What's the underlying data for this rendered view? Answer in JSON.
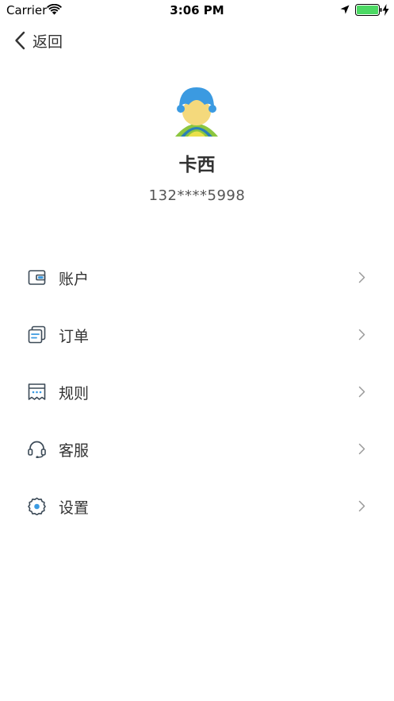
{
  "status_bar": {
    "carrier": "Carrier",
    "time": "3:06 PM",
    "battery_level": 1.0,
    "battery_color": "#4cd964"
  },
  "nav": {
    "back_label": "返回"
  },
  "profile": {
    "name": "卡西",
    "phone": "132****5998"
  },
  "menu": {
    "items": [
      {
        "label": "账户",
        "icon": "wallet-icon"
      },
      {
        "label": "订单",
        "icon": "order-icon"
      },
      {
        "label": "规则",
        "icon": "rules-icon"
      },
      {
        "label": "客服",
        "icon": "headset-icon"
      },
      {
        "label": "设置",
        "icon": "settings-icon"
      }
    ]
  },
  "colors": {
    "accent_blue": "#3b9ae1",
    "icon_stroke": "#3c4a57",
    "chevron": "#9a9a9a",
    "avatar_face": "#f4d97c",
    "avatar_green": "#8cc63f"
  }
}
